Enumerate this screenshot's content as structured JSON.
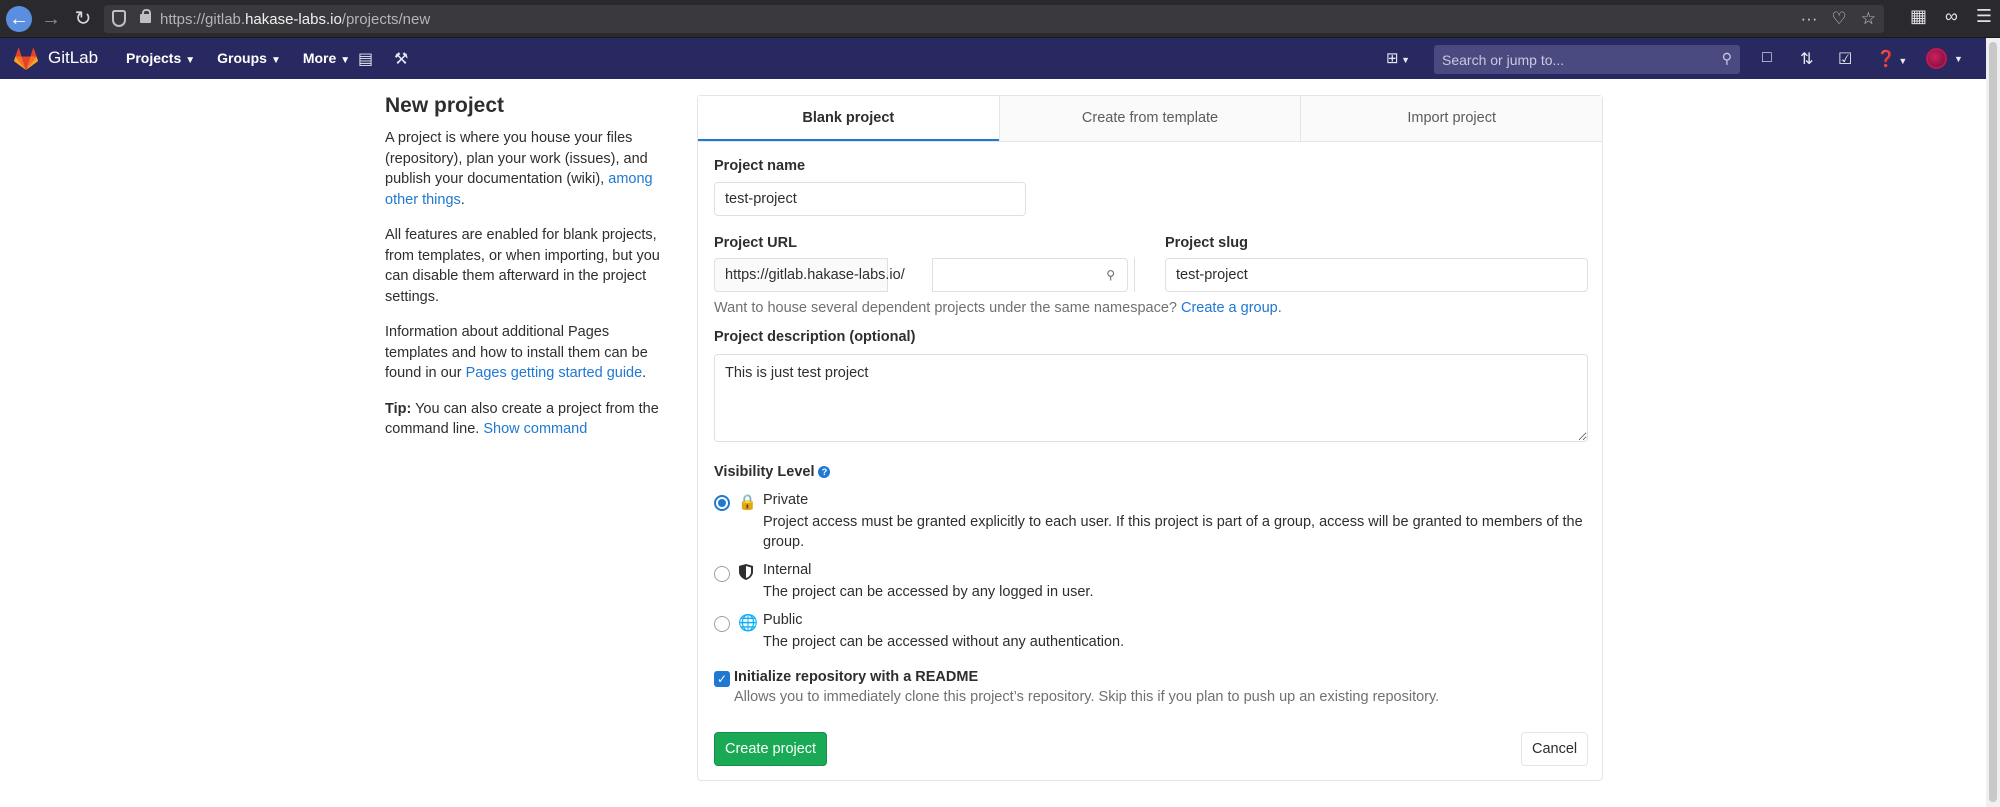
{
  "browser": {
    "url_prefix": "https://gitlab.",
    "url_host": "hakase-labs.io",
    "url_path": "/projects/new"
  },
  "header": {
    "brand": "GitLab",
    "nav": [
      {
        "label": "Projects"
      },
      {
        "label": "Groups"
      },
      {
        "label": "More"
      }
    ],
    "search_placeholder": "Search or jump to..."
  },
  "sidebar": {
    "title": "New project",
    "para1_text": "A project is where you house your files (repository), plan your work (issues), and publish your documentation (wiki),",
    "para1_link": "among other things",
    "para1_end": ".",
    "para2": "All features are enabled for blank projects, from templates, or when importing, but you can disable them afterward in the project settings.",
    "para3_text": "Information about additional Pages templates and how to install them can be found in our",
    "para3_link": "Pages getting started guide",
    "para3_end": ".",
    "tip_label": "Tip:",
    "tip_text": "You can also create a project from the command line.",
    "tip_link": "Show command"
  },
  "tabs": [
    {
      "label": "Blank project",
      "active": true
    },
    {
      "label": "Create from template",
      "active": false
    },
    {
      "label": "Import project",
      "active": false
    }
  ],
  "form": {
    "name_label": "Project name",
    "name_value": "test-project",
    "url_label": "Project URL",
    "url_prefix": "https://gitlab.hakase-labs.io/",
    "slug_label": "Project slug",
    "slug_value": "test-project",
    "namespace_help": "Want to house several dependent projects under the same namespace?",
    "namespace_link": "Create a group.",
    "desc_label": "Project description (optional)",
    "desc_value": "This is just test project",
    "visibility_label": "Visibility Level",
    "visibility": [
      {
        "title": "Private",
        "desc": "Project access must be granted explicitly to each user. If this project is part of a group, access will be granted to members of the group.",
        "checked": true,
        "icon": "lock-icon"
      },
      {
        "title": "Internal",
        "desc": "The project can be accessed by any logged in user.",
        "checked": false,
        "icon": "shield-icon"
      },
      {
        "title": "Public",
        "desc": "The project can be accessed without any authentication.",
        "checked": false,
        "icon": "globe-icon"
      }
    ],
    "readme_label": "Initialize repository with a README",
    "readme_desc": "Allows you to immediately clone this project’s repository. Skip this if you plan to push up an existing repository.",
    "readme_checked": true,
    "create_button": "Create project",
    "cancel_button": "Cancel"
  },
  "colors": {
    "header_bg": "#292961",
    "link": "#1f78d1",
    "primary_button": "#1aaa55"
  }
}
